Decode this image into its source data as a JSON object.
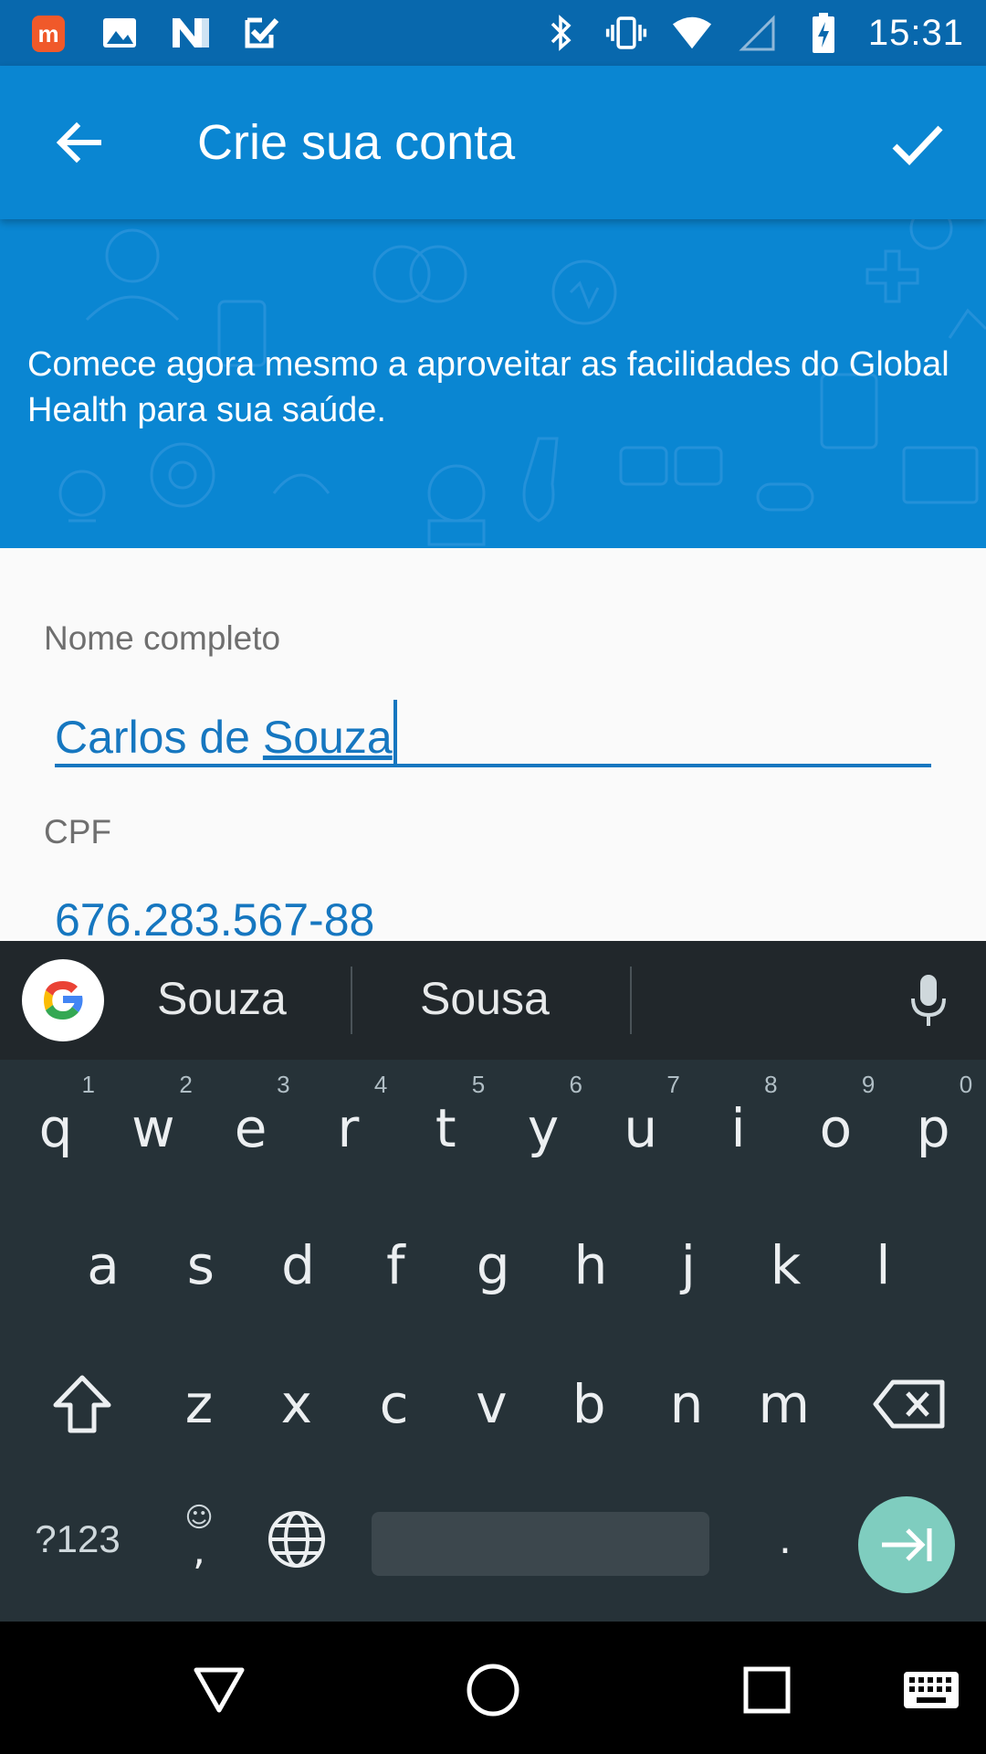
{
  "status_bar": {
    "time": "15:31",
    "left_icons": [
      "m-app-icon",
      "image-icon",
      "n-app-icon",
      "task-check-icon"
    ],
    "right_icons": [
      "bluetooth-icon",
      "vibrate-icon",
      "wifi-icon",
      "signal-icon",
      "battery-charging-icon"
    ]
  },
  "app_bar": {
    "title": "Crie sua conta",
    "back_icon": "arrow-back-icon",
    "confirm_icon": "check-icon"
  },
  "banner": {
    "description": "Comece agora mesmo a aproveitar as facilidades do Global Health para sua saúde."
  },
  "form": {
    "name": {
      "label": "Nome completo",
      "value_prefix": "Carlos de ",
      "value_composing": "Souza"
    },
    "cpf": {
      "label": "CPF",
      "value": "676.283.567-88"
    }
  },
  "keyboard": {
    "suggestions": [
      "Souza",
      "Sousa"
    ],
    "row1": [
      {
        "key": "q",
        "hint": "1"
      },
      {
        "key": "w",
        "hint": "2"
      },
      {
        "key": "e",
        "hint": "3"
      },
      {
        "key": "r",
        "hint": "4"
      },
      {
        "key": "t",
        "hint": "5"
      },
      {
        "key": "y",
        "hint": "6"
      },
      {
        "key": "u",
        "hint": "7"
      },
      {
        "key": "i",
        "hint": "8"
      },
      {
        "key": "o",
        "hint": "9"
      },
      {
        "key": "p",
        "hint": "0"
      }
    ],
    "row2": [
      "a",
      "s",
      "d",
      "f",
      "g",
      "h",
      "j",
      "k",
      "l"
    ],
    "row3": [
      "z",
      "x",
      "c",
      "v",
      "b",
      "n",
      "m"
    ],
    "symbols_label": "?123",
    "comma_label": ",",
    "period_label": "."
  },
  "colors": {
    "status_bar": "#0868ad",
    "app_bar": "#0a86d2",
    "accent": "#1677c0",
    "keyboard_bg": "#263238",
    "enter_key": "#7fcdbf"
  }
}
